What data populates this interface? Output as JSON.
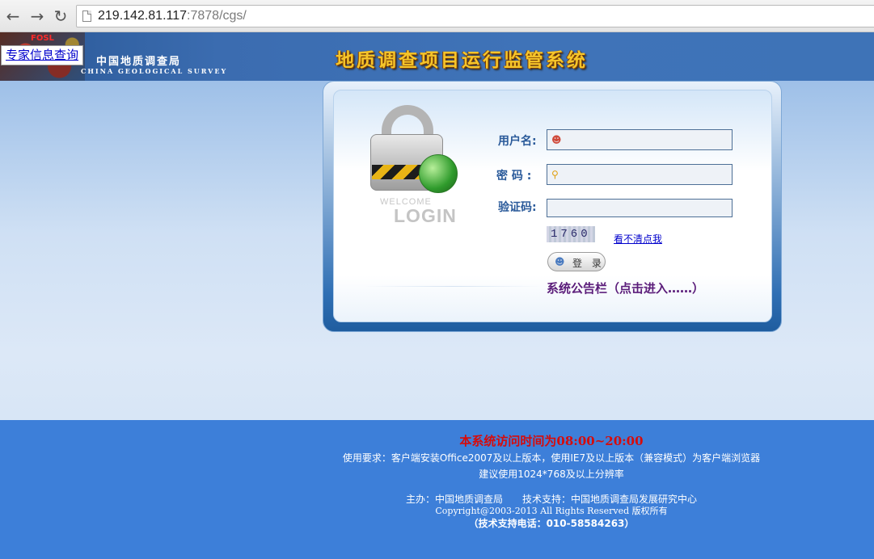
{
  "browser": {
    "back_icon": "back-arrow-icon",
    "forward_icon": "forward-arrow-icon",
    "reload_icon": "reload-icon",
    "url_host": "219.142.81.117",
    "url_rest": ":7878/cgs/"
  },
  "header": {
    "mark": "FOSL",
    "expert_link": "专家信息查询",
    "agency_cn": "中国地质调查局",
    "agency_en": "CHINA GEOLOGICAL SURVEY",
    "system_title": "地质调查项目运行监管系统",
    "title_color": "#f5c52a"
  },
  "login": {
    "welcome_text": "WELCOME",
    "login_text": "LOGIN",
    "username_label": "用户名:",
    "username_value": "",
    "password_label": "密 码 :",
    "password_value": "",
    "captcha_label": "验证码:",
    "captcha_value": "",
    "captcha_image_text": "1760",
    "refresh_link": "看不清点我",
    "login_button": "登 录",
    "notice_link": "系统公告栏（点击进入……）"
  },
  "footer": {
    "access_time": "本系统访问时间为08:00~20:00",
    "requirements": "使用要求：客户端安装Office2007及以上版本，使用IE7及以上版本（兼容模式）为客户端浏览器",
    "resolution": "建议使用1024*768及以上分辨率",
    "host": "主办：中国地质调查局　　技术支持：中国地质调查局发展研究中心",
    "copyright": "Copyright@2003-2013 All Rights Reserved 版权所有",
    "phone": "（技术支持电话：010-58584263）"
  }
}
